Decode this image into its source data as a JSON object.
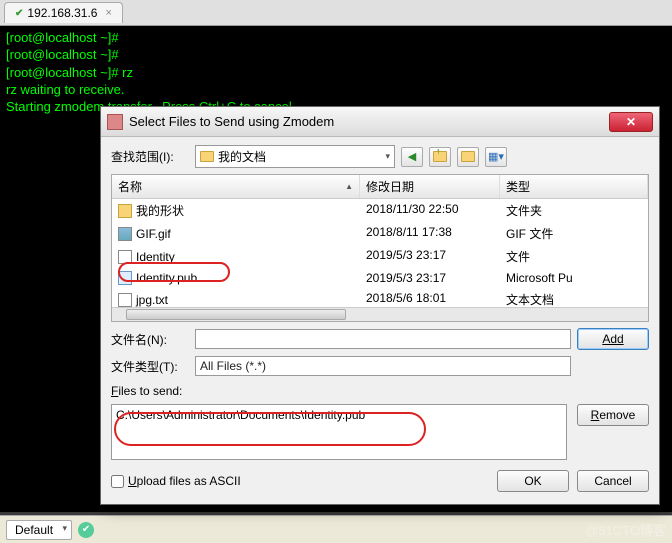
{
  "tab": {
    "host": "192.168.31.6"
  },
  "terminal": {
    "lines": [
      "[root@localhost ~]#",
      "[root@localhost ~]#",
      "[root@localhost ~]# rz",
      "rz waiting to receive.",
      "Starting zmodem transfer.  Press Ctrl+C to cancel."
    ]
  },
  "status": {
    "mode": "Default"
  },
  "dialog": {
    "title": "Select Files to Send using Zmodem",
    "lookin_label": "查找范围(I):",
    "lookin_value": "我的文档",
    "columns": {
      "name": "名称",
      "date": "修改日期",
      "type": "类型"
    },
    "files": [
      {
        "icon": "folder",
        "name": "我的形状",
        "date": "2018/11/30 22:50",
        "type": "文件夹"
      },
      {
        "icon": "img",
        "name": "GIF.gif",
        "date": "2018/8/11 17:38",
        "type": "GIF 文件"
      },
      {
        "icon": "txt",
        "name": "Identity",
        "date": "2019/5/3 23:17",
        "type": "文件"
      },
      {
        "icon": "cert",
        "name": "Identity.pub",
        "date": "2019/5/3 23:17",
        "type": "Microsoft Pu"
      },
      {
        "icon": "txt",
        "name": "jpg.txt",
        "date": "2018/5/6 18:01",
        "type": "文本文档"
      }
    ],
    "filename_label": "文件名(N):",
    "filename_value": "",
    "filetype_label": "文件类型(T):",
    "filetype_value": "All Files (*.*)",
    "add_label": "Add",
    "files_to_send_label": "Files to send:",
    "files_to_send_value": "C:\\Users\\Administrator\\Documents\\Identity.pub",
    "remove_label": "Remove",
    "ascii_label": "Upload files as ASCII",
    "ok_label": "OK",
    "cancel_label": "Cancel"
  },
  "watermark": "@51CTO博客"
}
